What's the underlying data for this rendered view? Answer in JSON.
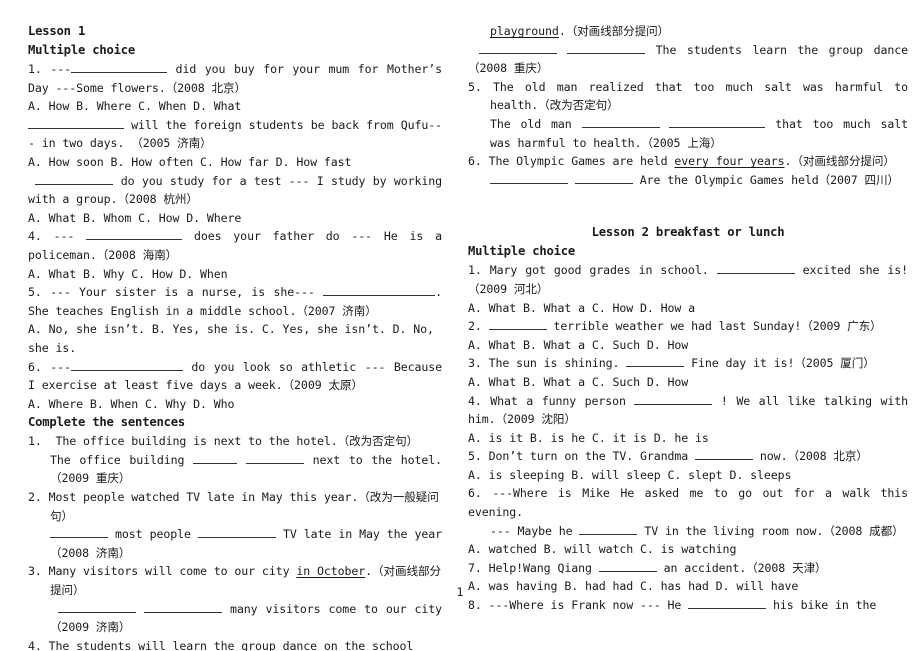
{
  "document": {
    "page_number": "1",
    "background_color": "#ffffff",
    "text_color": "#1a1a1a"
  },
  "left_column": {
    "lesson_heading": "Lesson 1",
    "section_heading": "Multiple choice",
    "multiple_choice": [
      {
        "number": "1.",
        "stem": "--- ________ did you buy for your mum for Mother's Day ---Some flowers.(2008 北京)",
        "stem_part_a": "1.  ---",
        "stem_part_b": " did you buy for your mum for Mother’s Day ---Some flowers.（2008 北京）",
        "options": "A. How        B. Where        C. When       D. What"
      },
      {
        "number": "",
        "stem_part_a": "",
        "stem_part_b": " will the foreign students be back from Qufu--- in two days. （2005 济南）",
        "options": "A. How soon     B. How often      C. How far   D. How fast"
      },
      {
        "number": "",
        "stem_part_a": "",
        "stem_part_b": " do you study for a test --- I study by working with a group.（2008 杭州）",
        "options": "A. What       B. Whom      C. How       D. Where"
      },
      {
        "number": "4.",
        "stem_part_a": "4.  --- ",
        "stem_part_b": " does your father do --- He is a policeman.（2008 海南）",
        "options": "A. What      B. Why      C. How      D. When"
      },
      {
        "number": "5.",
        "stem_part_a": "5.  --- Your sister is a nurse, is she--- ",
        "stem_part_b": ". She teaches English in a middle school.（2007 济南）",
        "options": "A. No, she isn’t.     B. Yes, she is.     C. Yes, she isn’t.  D. No, she is."
      },
      {
        "number": "6.",
        "stem_part_a": "6.  ---",
        "stem_part_b": " do you look so athletic --- Because I exercise at least five days a week.（2009 太原）",
        "options": "A. Where       B. When       C. Why       D. Who"
      }
    ],
    "complete_heading": "Complete the sentences",
    "complete_sentences": [
      {
        "number": "1.",
        "prompt": "The office building is next to the hotel.（改为否定句）",
        "answer_a": "The office building ",
        "answer_b": " next to the hotel.（2009 重庆）"
      },
      {
        "number": "2.",
        "prompt": "Most people watched TV late in May this year.（改为一般疑问句）",
        "answer_a": "",
        "answer_mid": " most people ",
        "answer_b": " TV late in May the year（2008 济南）"
      },
      {
        "number": "3.",
        "prompt": "Many visitors will come to our city in October.（对画线部分提问）",
        "prompt_plain": "Many visitors will come to our city ",
        "prompt_underlined": "in October",
        "prompt_tail": ".（对画线部分提问）",
        "answer_b": " many visitors come to our city（2009 济南）"
      },
      {
        "number": "4.",
        "prompt_plain": "The students will learn the group dance ",
        "prompt_underlined": "on the school"
      }
    ]
  },
  "right_column": {
    "continued": {
      "underlined_word": "playground",
      "tail": ".（对画线部分提问）",
      "answer_tail": " The students learn the group dance（2008 重庆）"
    },
    "complete_sentences": [
      {
        "number": "5.",
        "prompt": "The old man realized that too much salt was harmful to health.（改为否定句）",
        "answer_a": "The old man ",
        "answer_b": " that too much salt was harmful to health.（2005 上海）"
      },
      {
        "number": "6.",
        "prompt_plain": "The Olympic Games are held ",
        "prompt_underlined": "every four years",
        "prompt_tail": ".（对画线部分提问）",
        "answer_b": " Are the Olympic Games held（2007 四川）"
      }
    ],
    "lesson_heading": "Lesson 2 breakfast or lunch",
    "section_heading": "Multiple choice",
    "multiple_choice": [
      {
        "number": "1.",
        "stem_part_a": "1. Mary got good grades in school. ",
        "stem_part_b": " excited she is!（2009 河北）",
        "options": "A. What      B. What a     C. How     D. How a"
      },
      {
        "number": "2.",
        "stem_part_a": "2.  ",
        "stem_part_b": " terrible weather we had last Sunday!（2009 广东）",
        "options": "A. What     B. What a     C. Such     D. How"
      },
      {
        "number": "3.",
        "stem_part_a": "3. The sun is shining. ",
        "stem_part_b": " Fine day it is!（2005 厦门）",
        "options": "A. What     B. What a     C. Such     D. How"
      },
      {
        "number": "4.",
        "stem_part_a": "4.  What a funny person ",
        "stem_part_b": " ! We all like talking with him.（2009 沈阳）",
        "options": "A. is it     B. is he     C. it is     D. he is"
      },
      {
        "number": "5.",
        "stem_part_a": "5. Don’t turn on the TV. Grandma ",
        "stem_part_b": " now.（2008 北京）",
        "options": "A. is sleeping      B. will sleep     C. slept     D. sleeps"
      },
      {
        "number": "6.",
        "stem_part_a": "6. ---Where is Mike He asked me to go out for a walk this evening.",
        "stem_sub_a": "--- Maybe he ",
        "stem_sub_b": " TV in the living room now.（2008 成都）",
        "options": "A. watched      B. will watch     C. is watching"
      },
      {
        "number": "7.",
        "stem_part_a": "7. Help!Wang Qiang ",
        "stem_part_b": " an accident.（2008 天津）",
        "options": "A. was having     B. had had     C. has had      D. will have"
      },
      {
        "number": "8.",
        "stem_part_a": "8.  ---Where is Frank now --- He ",
        "stem_part_b": " his bike in the",
        "options": ""
      }
    ]
  }
}
